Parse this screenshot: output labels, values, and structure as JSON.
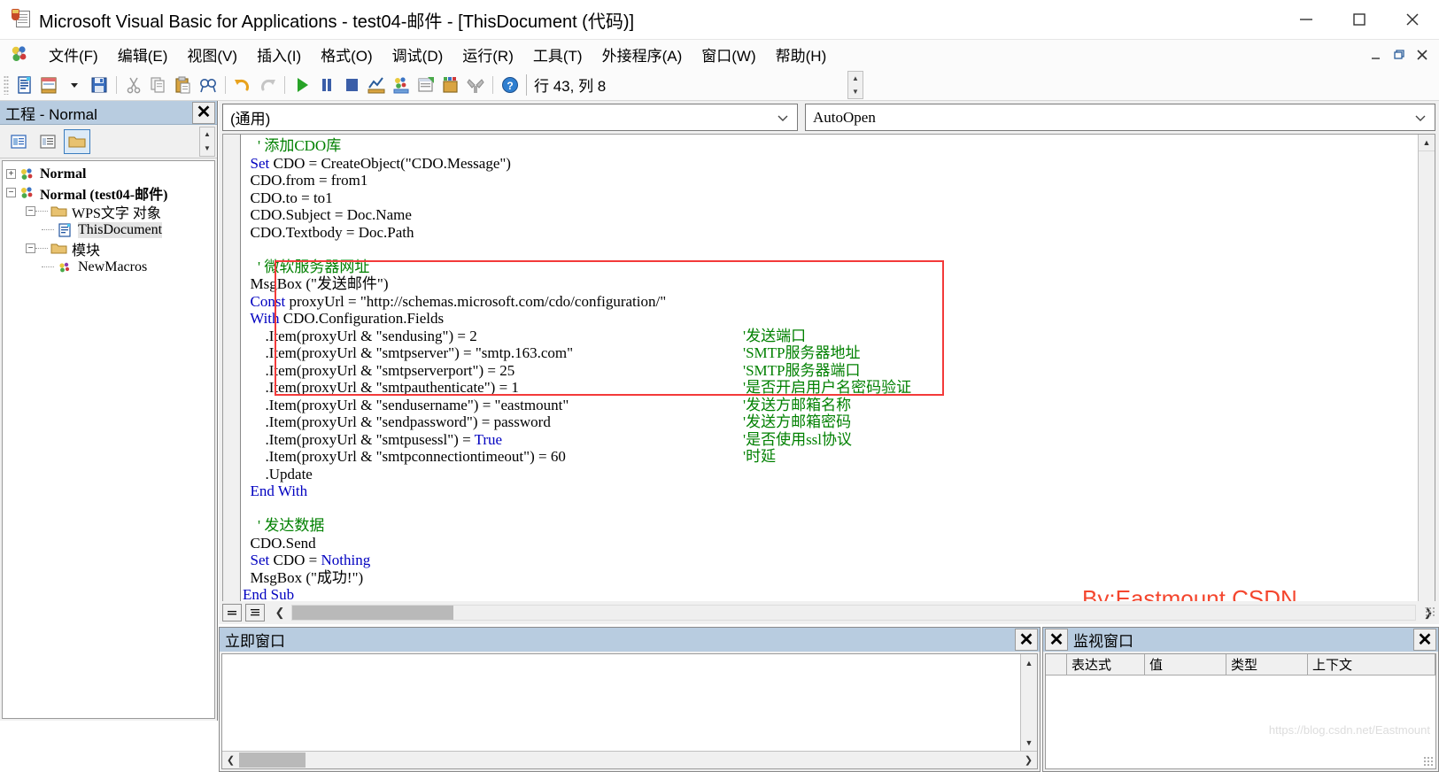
{
  "titlebar": {
    "title": "Microsoft Visual Basic for Applications - test04-邮件 - [ThisDocument (代码)]",
    "minimize": "−",
    "maximize": "□",
    "close": "✕"
  },
  "menubar": {
    "items": [
      {
        "label": "文件(F)",
        "accel": "F"
      },
      {
        "label": "编辑(E)",
        "accel": "E"
      },
      {
        "label": "视图(V)",
        "accel": "V"
      },
      {
        "label": "插入(I)",
        "accel": "I"
      },
      {
        "label": "格式(O)",
        "accel": "O"
      },
      {
        "label": "调试(D)",
        "accel": "D"
      },
      {
        "label": "运行(R)",
        "accel": "R"
      },
      {
        "label": "工具(T)",
        "accel": "T"
      },
      {
        "label": "外接程序(A)",
        "accel": "A"
      },
      {
        "label": "窗口(W)",
        "accel": "W"
      },
      {
        "label": "帮助(H)",
        "accel": "H"
      }
    ],
    "right_buttons": [
      "minimize-doc",
      "restore-doc",
      "close-doc"
    ]
  },
  "toolbar": {
    "position_text": "行 43, 列 8",
    "icons": [
      "view-code-icon",
      "design-mode-icon",
      "dropdown-arrow-icon",
      "save-icon",
      "cut-icon",
      "copy-icon",
      "paste-icon",
      "find-icon",
      "undo-icon",
      "redo-icon",
      "run-icon",
      "break-icon",
      "reset-icon",
      "design-toggle-icon",
      "project-explorer-icon",
      "properties-window-icon",
      "object-browser-icon",
      "toolbox-icon",
      "help-icon"
    ]
  },
  "project_panel": {
    "title": "工程 - Normal",
    "close_label": "✕",
    "toolbar_icons": [
      "view-code-icon",
      "view-object-icon",
      "toggle-folders-icon"
    ],
    "tree": [
      {
        "indent": 0,
        "expander": "+",
        "icon": "vba-project-icon",
        "label": "Normal",
        "bold": true,
        "selected": false
      },
      {
        "indent": 0,
        "expander": "−",
        "icon": "vba-project-icon",
        "label": "Normal (test04-邮件)",
        "bold": true,
        "selected": false
      },
      {
        "indent": 1,
        "expander": "−",
        "icon": "folder-icon",
        "label": "WPS文字 对象",
        "bold": false,
        "selected": false
      },
      {
        "indent": 2,
        "expander": "",
        "icon": "document-icon",
        "label": "ThisDocument",
        "bold": false,
        "selected": true
      },
      {
        "indent": 1,
        "expander": "−",
        "icon": "folder-icon",
        "label": "模块",
        "bold": false,
        "selected": false
      },
      {
        "indent": 2,
        "expander": "",
        "icon": "module-icon",
        "label": "NewMacros",
        "bold": false,
        "selected": false
      }
    ]
  },
  "code_pane": {
    "object_dropdown": "(通用)",
    "procedure_dropdown": "AutoOpen",
    "watermark": "By:Eastmount CSDN",
    "lines": [
      {
        "indent": 4,
        "segments": [
          {
            "t": "' 添加CDO库",
            "c": "cm"
          }
        ]
      },
      {
        "indent": 2,
        "segments": [
          {
            "t": "Set",
            "c": "kw"
          },
          {
            "t": " CDO = CreateObject(\"CDO.Message\")",
            "c": ""
          }
        ]
      },
      {
        "indent": 2,
        "segments": [
          {
            "t": "CDO.from = from1",
            "c": ""
          }
        ]
      },
      {
        "indent": 2,
        "segments": [
          {
            "t": "CDO.to = to1",
            "c": ""
          }
        ]
      },
      {
        "indent": 2,
        "segments": [
          {
            "t": "CDO.Subject = Doc.Name",
            "c": ""
          }
        ]
      },
      {
        "indent": 2,
        "segments": [
          {
            "t": "CDO.Textbody = Doc.Path",
            "c": ""
          }
        ]
      },
      {
        "indent": 0,
        "segments": []
      },
      {
        "indent": 4,
        "segments": [
          {
            "t": "' 微软服务器网址",
            "c": "cm"
          }
        ]
      },
      {
        "indent": 2,
        "segments": [
          {
            "t": "MsgBox (\"发送邮件\")",
            "c": ""
          }
        ]
      },
      {
        "indent": 2,
        "segments": [
          {
            "t": "Const",
            "c": "kw"
          },
          {
            "t": " proxyUrl = \"http://schemas.microsoft.com/cdo/configuration/\"",
            "c": ""
          }
        ]
      },
      {
        "indent": 2,
        "segments": [
          {
            "t": "With",
            "c": "kw"
          },
          {
            "t": " CDO.Configuration.Fields",
            "c": ""
          }
        ]
      },
      {
        "indent": 6,
        "segments": [
          {
            "t": ".Item(proxyUrl & \"sendusing\") = 2",
            "c": ""
          }
        ],
        "comment": "'发送端口"
      },
      {
        "indent": 6,
        "segments": [
          {
            "t": ".Item(proxyUrl & \"smtpserver\") = \"smtp.163.com\"",
            "c": ""
          }
        ],
        "comment": "'SMTP服务器地址"
      },
      {
        "indent": 6,
        "segments": [
          {
            "t": ".Item(proxyUrl & \"smtpserverport\") = 25",
            "c": ""
          }
        ],
        "comment": "'SMTP服务器端口"
      },
      {
        "indent": 6,
        "segments": [
          {
            "t": ".Item(proxyUrl & \"smtpauthenticate\") = 1",
            "c": ""
          }
        ],
        "comment": "'是否开启用户名密码验证"
      },
      {
        "indent": 6,
        "segments": [
          {
            "t": ".Item(proxyUrl & \"sendusername\") = \"eastmount\"",
            "c": ""
          }
        ],
        "comment": "'发送方邮箱名称"
      },
      {
        "indent": 6,
        "segments": [
          {
            "t": ".Item(proxyUrl & \"sendpassword\") = password",
            "c": ""
          }
        ],
        "comment": "'发送方邮箱密码"
      },
      {
        "indent": 6,
        "segments": [
          {
            "t": ".Item(proxyUrl & \"smtpusessl\") = ",
            "c": ""
          },
          {
            "t": "True",
            "c": "kw"
          }
        ],
        "comment": "'是否使用ssl协议"
      },
      {
        "indent": 6,
        "segments": [
          {
            "t": ".Item(proxyUrl & \"smtpconnectiontimeout\") = 60",
            "c": ""
          }
        ],
        "comment": "'时延"
      },
      {
        "indent": 6,
        "segments": [
          {
            "t": ".Update",
            "c": ""
          }
        ]
      },
      {
        "indent": 2,
        "segments": [
          {
            "t": "End With",
            "c": "kw"
          }
        ]
      },
      {
        "indent": 0,
        "segments": []
      },
      {
        "indent": 4,
        "segments": [
          {
            "t": "' 发达数据",
            "c": "cm"
          }
        ]
      },
      {
        "indent": 2,
        "segments": [
          {
            "t": "CDO.Send",
            "c": ""
          }
        ]
      },
      {
        "indent": 2,
        "segments": [
          {
            "t": "Set",
            "c": "kw"
          },
          {
            "t": " CDO = ",
            "c": ""
          },
          {
            "t": "Nothing",
            "c": "kw"
          }
        ]
      },
      {
        "indent": 2,
        "segments": [
          {
            "t": "MsgBox (\"成功!\")",
            "c": ""
          }
        ]
      },
      {
        "indent": 0,
        "segments": [
          {
            "t": "End Sub",
            "c": "kw"
          }
        ]
      }
    ]
  },
  "immediate_window": {
    "title": "立即窗口",
    "close_label": "✕",
    "content": ""
  },
  "watch_window": {
    "title": "监视窗口",
    "close_left_label": "✕",
    "close_right_label": "✕",
    "columns": [
      "表达式",
      "值",
      "类型",
      "上下文"
    ],
    "rows": [],
    "watermark": "https://blog.csdn.net/Eastmount"
  },
  "colors": {
    "title_bar_bg": "#ffffff",
    "panel_title_bg": "#b8cce0",
    "keyword": "#0000c0",
    "comment": "#008000",
    "highlight_box": "#f33a3a",
    "watermark_red": "#f4462e",
    "toolbar_bg": "#fbfbfb"
  }
}
